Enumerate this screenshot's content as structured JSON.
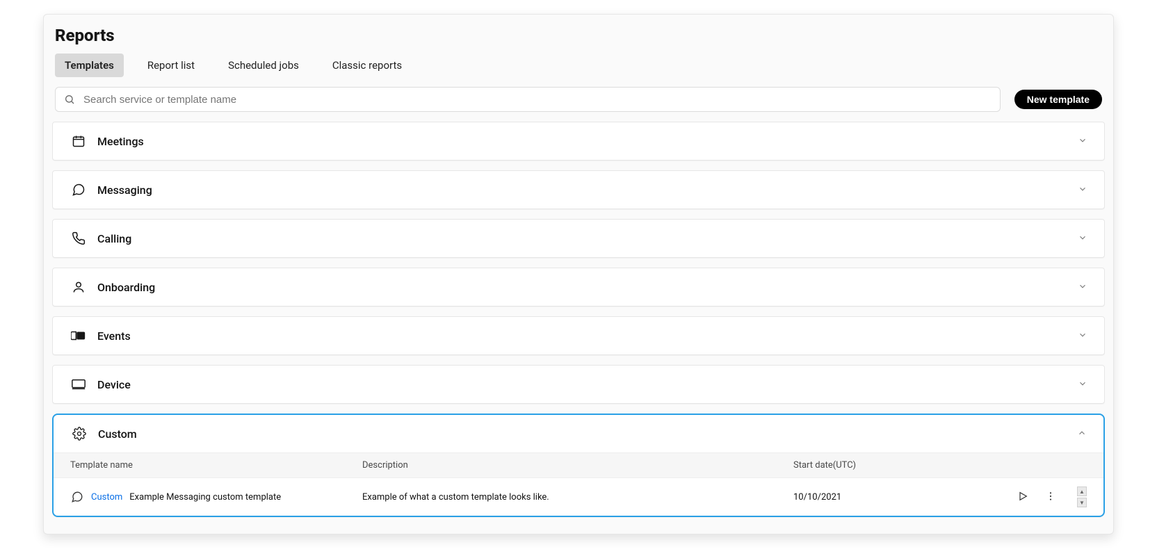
{
  "page_title": "Reports",
  "tabs": [
    {
      "label": "Templates",
      "active": true
    },
    {
      "label": "Report list",
      "active": false
    },
    {
      "label": "Scheduled jobs",
      "active": false
    },
    {
      "label": "Classic reports",
      "active": false
    }
  ],
  "search_placeholder": "Search service or template name",
  "new_template_label": "New template",
  "groups": [
    {
      "icon": "calendar",
      "label": "Meetings",
      "expanded": false
    },
    {
      "icon": "chat",
      "label": "Messaging",
      "expanded": false
    },
    {
      "icon": "phone",
      "label": "Calling",
      "expanded": false
    },
    {
      "icon": "user",
      "label": "Onboarding",
      "expanded": false
    },
    {
      "icon": "ticket",
      "label": "Events",
      "expanded": false
    },
    {
      "icon": "device",
      "label": "Device",
      "expanded": false
    }
  ],
  "custom_group": {
    "icon": "gear",
    "label": "Custom",
    "table_headers": {
      "name": "Template name",
      "description": "Description",
      "date": "Start date(UTC)"
    },
    "rows": [
      {
        "row_icon": "chat",
        "badge": "Custom",
        "name": "Example Messaging custom template",
        "description": "Example of what a custom template looks like.",
        "date": "10/10/2021"
      }
    ]
  }
}
